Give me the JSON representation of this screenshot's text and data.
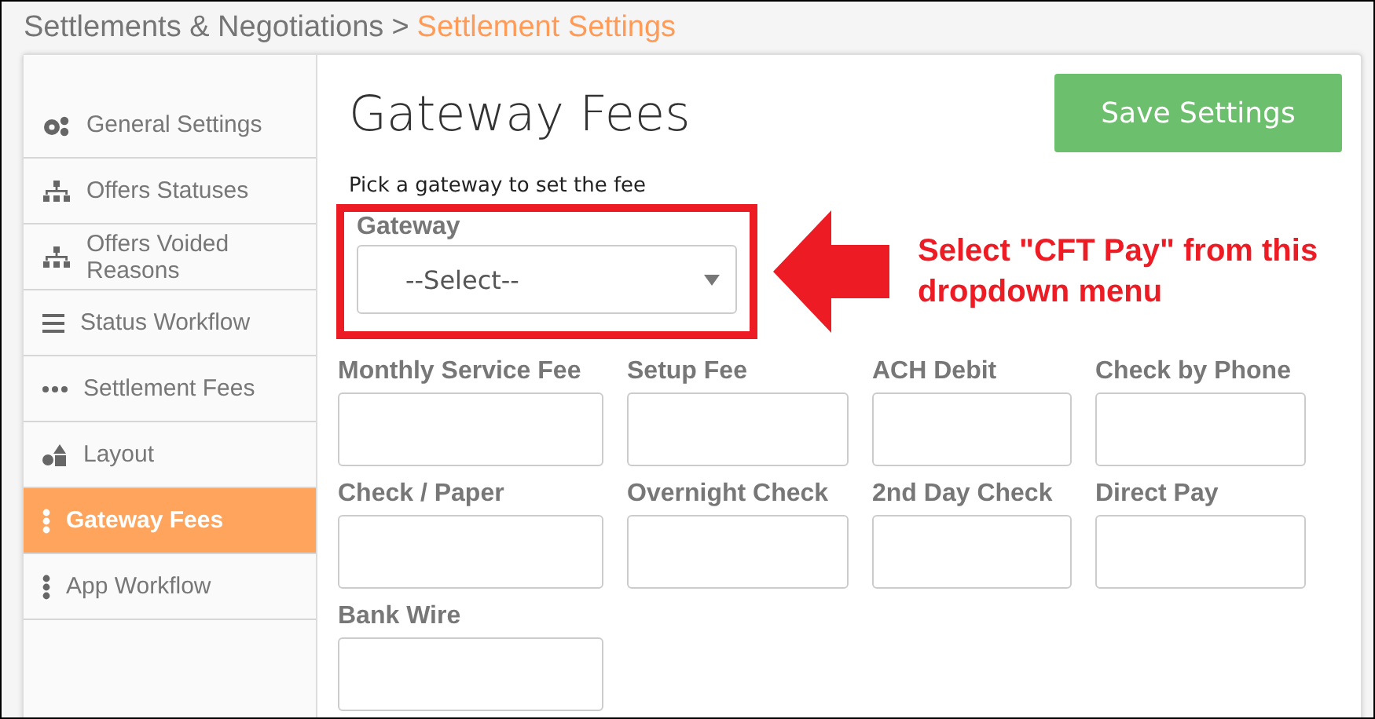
{
  "breadcrumb": {
    "parent": "Settlements & Negotiations",
    "separator": ">",
    "current": "Settlement Settings"
  },
  "sidebar": {
    "items": [
      {
        "label": "General Settings",
        "kind": "gears",
        "selected": false
      },
      {
        "label": "Offers Statuses",
        "kind": "sitemap",
        "selected": false
      },
      {
        "label": "Offers Voided Reasons",
        "kind": "sitemap",
        "selected": false
      },
      {
        "label": "Status Workflow",
        "kind": "bars",
        "selected": false
      },
      {
        "label": "Settlement Fees",
        "kind": "dots",
        "selected": false
      },
      {
        "label": "Layout",
        "kind": "shapes",
        "selected": false
      },
      {
        "label": "Gateway Fees",
        "kind": "vdots",
        "selected": true
      },
      {
        "label": "App Workflow",
        "kind": "vdots",
        "selected": false
      }
    ]
  },
  "main": {
    "title": "Gateway Fees",
    "save_button": "Save Settings",
    "hint": "Pick a gateway to set the fee",
    "gateway": {
      "label": "Gateway",
      "value": "--Select--"
    },
    "annotation": {
      "text": "Select \"CFT Pay\" from this dropdown menu"
    },
    "fees": [
      {
        "label": "Monthly Service Fee"
      },
      {
        "label": "Setup Fee"
      },
      {
        "label": "ACH Debit"
      },
      {
        "label": "Check by Phone"
      },
      {
        "label": "Check / Paper"
      },
      {
        "label": "Overnight Check"
      },
      {
        "label": "2nd Day Check"
      },
      {
        "label": "Direct Pay"
      },
      {
        "label": "Bank Wire"
      }
    ]
  }
}
